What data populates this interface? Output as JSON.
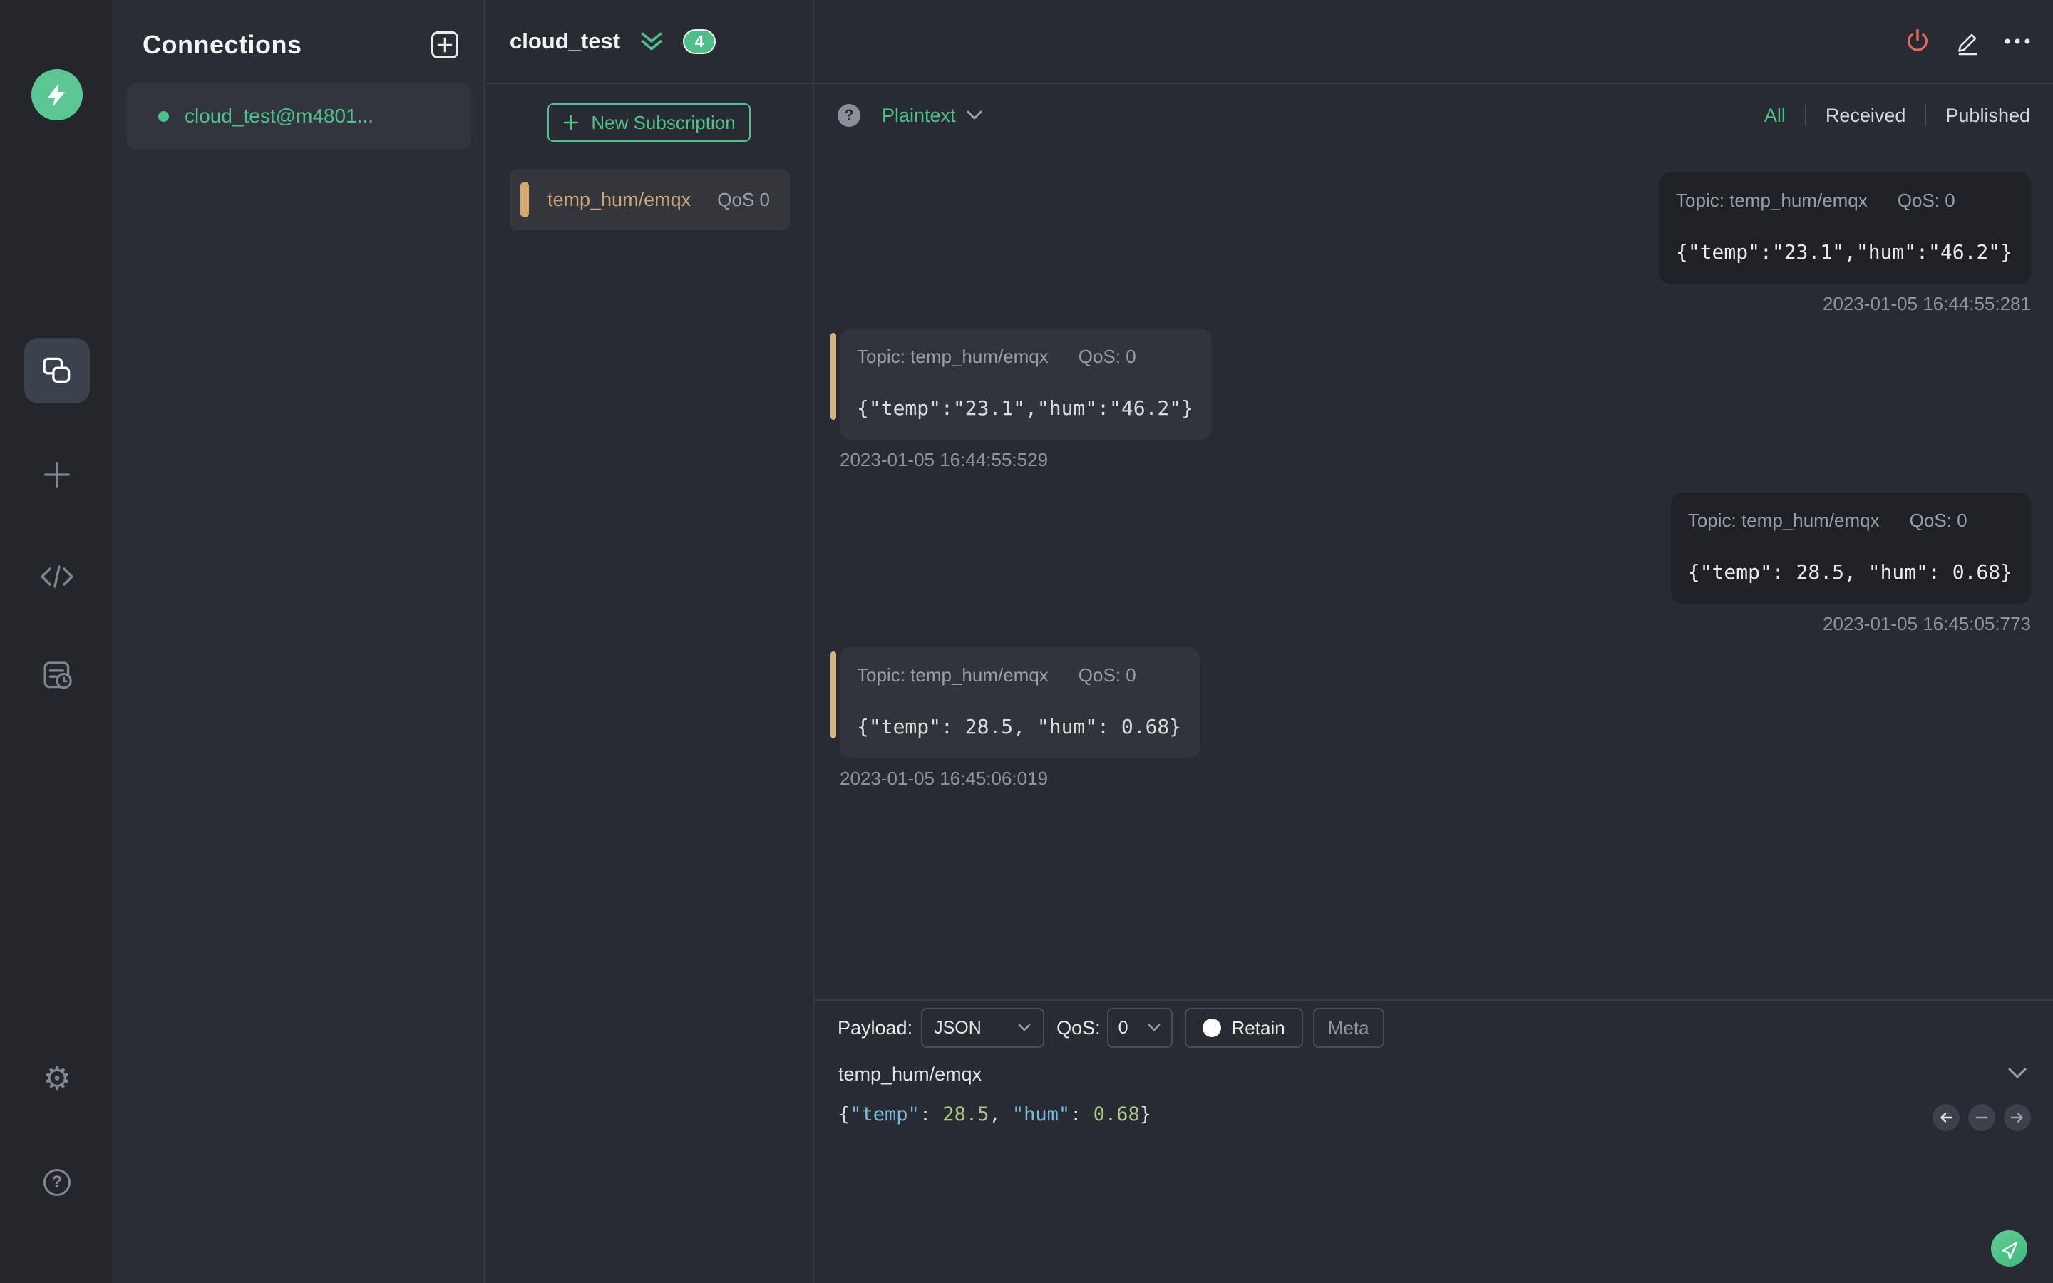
{
  "colors": {
    "accent_green": "#4fc08d",
    "topic_tan": "#cba679",
    "bar_tan": "#d8b183",
    "danger_red": "#e2685f",
    "json_key_blue": "#7cb8dc",
    "json_number_green": "#a9c789"
  },
  "connections_panel": {
    "title": "Connections",
    "items": [
      {
        "name": "cloud_test@m4801..."
      }
    ]
  },
  "connection_header": {
    "title": "cloud_test",
    "badge": "4"
  },
  "subscriptions": {
    "new_subscription_label": "New Subscription",
    "items": [
      {
        "topic": "temp_hum/emqx",
        "qos": "QoS 0"
      }
    ]
  },
  "messages_toolbar": {
    "format": "Plaintext",
    "filters": {
      "all": "All",
      "received": "Received",
      "published": "Published"
    },
    "active_filter": "All"
  },
  "messages": [
    {
      "type": "published",
      "topic_label": "Topic: temp_hum/emqx",
      "qos_label": "QoS: 0",
      "payload": "{\"temp\":\"23.1\",\"hum\":\"46.2\"}",
      "timestamp": "2023-01-05 16:44:55:281"
    },
    {
      "type": "received",
      "topic_label": "Topic: temp_hum/emqx",
      "qos_label": "QoS: 0",
      "payload": "{\"temp\":\"23.1\",\"hum\":\"46.2\"}",
      "timestamp": "2023-01-05 16:44:55:529"
    },
    {
      "type": "published",
      "topic_label": "Topic: temp_hum/emqx",
      "qos_label": "QoS: 0",
      "payload": "{\"temp\": 28.5, \"hum\": 0.68}",
      "timestamp": "2023-01-05 16:45:05:773"
    },
    {
      "type": "received",
      "topic_label": "Topic: temp_hum/emqx",
      "qos_label": "QoS: 0",
      "payload": "{\"temp\": 28.5, \"hum\": 0.68}",
      "timestamp": "2023-01-05 16:45:06:019"
    }
  ],
  "publish": {
    "payload_label": "Payload:",
    "payload_format": "JSON",
    "qos_label": "QoS:",
    "qos_value": "0",
    "retain_label": "Retain",
    "meta_label": "Meta",
    "topic_value": "temp_hum/emqx",
    "payload_plain": "{\"temp\": 28.5, \"hum\": 0.68}",
    "payload_tokens": [
      {
        "text": "{",
        "color": "#d9dde2"
      },
      {
        "text": "\"temp\"",
        "color": "#7cb8dc"
      },
      {
        "text": ": ",
        "color": "#d9dde2"
      },
      {
        "text": "28.5",
        "color": "#a9c789"
      },
      {
        "text": ", ",
        "color": "#d9dde2"
      },
      {
        "text": "\"hum\"",
        "color": "#7cb8dc"
      },
      {
        "text": ": ",
        "color": "#d9dde2"
      },
      {
        "text": "0.68",
        "color": "#a9c789"
      },
      {
        "text": "}",
        "color": "#d9dde2"
      }
    ]
  }
}
